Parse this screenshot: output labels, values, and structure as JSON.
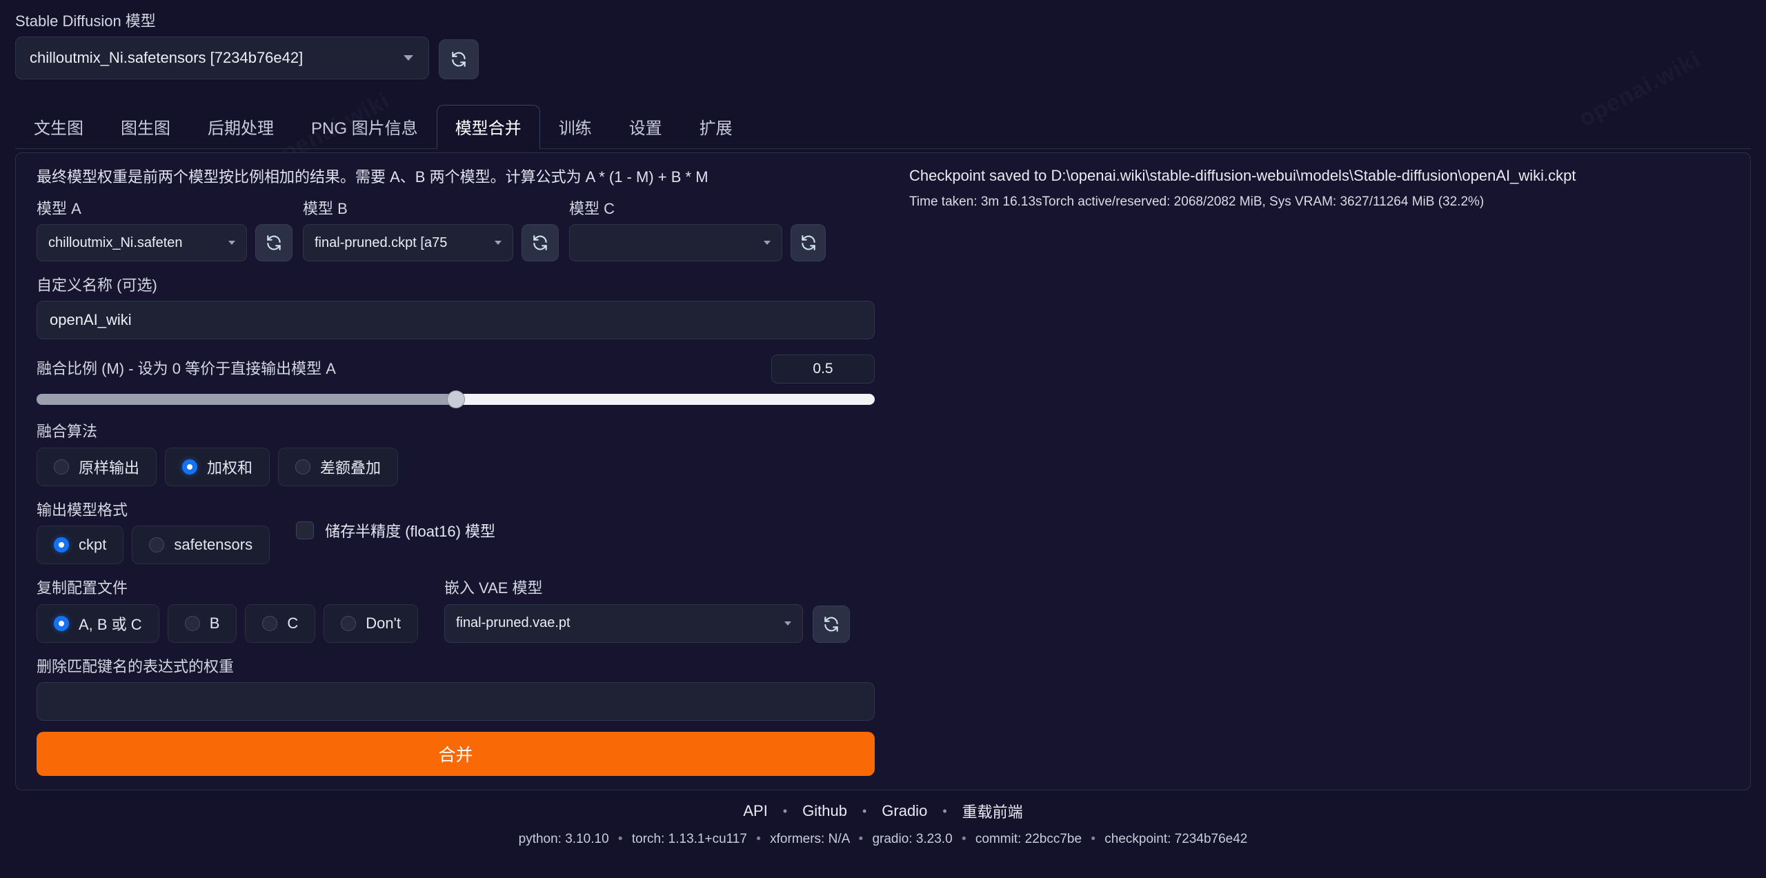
{
  "header": {
    "model_label": "Stable Diffusion 模型",
    "model_value": "chilloutmix_Ni.safetensors [7234b76e42]",
    "refresh_icon": "refresh-icon"
  },
  "tabs": [
    {
      "label": "文生图",
      "active": false
    },
    {
      "label": "图生图",
      "active": false
    },
    {
      "label": "后期处理",
      "active": false
    },
    {
      "label": "PNG 图片信息",
      "active": false
    },
    {
      "label": "模型合并",
      "active": true
    },
    {
      "label": "训练",
      "active": false
    },
    {
      "label": "设置",
      "active": false
    },
    {
      "label": "扩展",
      "active": false
    }
  ],
  "merge": {
    "intro": "最终模型权重是前两个模型按比例相加的结果。需要 A、B 两个模型。计算公式为 A * (1 - M) + B * M",
    "model_a_label": "模型 A",
    "model_a_value": "chilloutmix_Ni.safeten",
    "model_b_label": "模型 B",
    "model_b_value": "final-pruned.ckpt [a75",
    "model_c_label": "模型 C",
    "model_c_value": "",
    "custom_name_label": "自定义名称 (可选)",
    "custom_name_value": "openAI_wiki",
    "ratio_label": "融合比例 (M) - 设为 0 等价于直接输出模型 A",
    "ratio_value": "0.5",
    "ratio_percent": 50,
    "algo_label": "融合算法",
    "algo_options": [
      {
        "label": "原样输出",
        "checked": false
      },
      {
        "label": "加权和",
        "checked": true
      },
      {
        "label": "差额叠加",
        "checked": false
      }
    ],
    "format_label": "输出模型格式",
    "format_options": [
      {
        "label": "ckpt",
        "checked": true
      },
      {
        "label": "safetensors",
        "checked": false
      }
    ],
    "fp16_label": "储存半精度 (float16) 模型",
    "fp16_checked": false,
    "config_label": "复制配置文件",
    "config_options": [
      {
        "label": "A, B 或 C",
        "checked": true
      },
      {
        "label": "B",
        "checked": false
      },
      {
        "label": "C",
        "checked": false
      },
      {
        "label": "Don't",
        "checked": false
      }
    ],
    "vae_label": "嵌入 VAE 模型",
    "vae_value": "final-pruned.vae.pt",
    "regex_label": "删除匹配键名的表达式的权重",
    "regex_value": "",
    "merge_button": "合并"
  },
  "output": {
    "line1": "Checkpoint saved to D:\\openai.wiki\\stable-diffusion-webui\\models\\Stable-diffusion\\openAI_wiki.ckpt",
    "line2": "Time taken: 3m 16.13sTorch active/reserved: 2068/2082 MiB, Sys VRAM: 3627/11264 MiB (32.2%)"
  },
  "footer": {
    "links": [
      "API",
      "Github",
      "Gradio",
      "重载前端"
    ],
    "separator": "•",
    "version": [
      "python: 3.10.10",
      "torch: 1.13.1+cu117",
      "xformers: N/A",
      "gradio: 3.23.0",
      "commit: 22bcc7be",
      "checkpoint: 7234b76e42"
    ]
  },
  "watermark_text": "openai.wiki",
  "colors": {
    "background": "#14122b",
    "panel": "#16142e",
    "accent_orange": "#f96a06",
    "accent_blue": "#1472f5"
  }
}
